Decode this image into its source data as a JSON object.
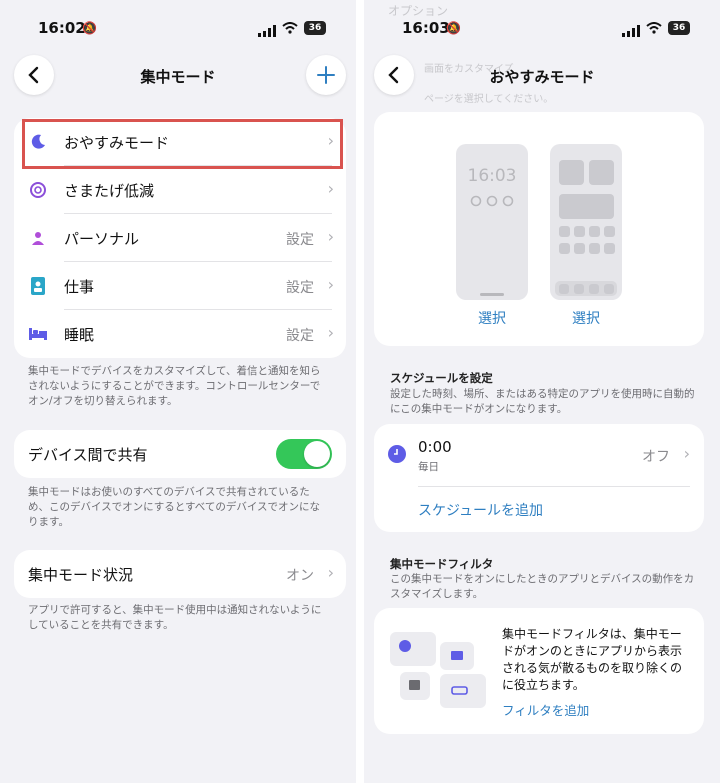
{
  "left": {
    "status": {
      "time": "16:02",
      "battery": "36"
    },
    "nav": {
      "title": "集中モード"
    },
    "modes": [
      {
        "label": "おやすみモード",
        "value": ""
      },
      {
        "label": "さまたげ低減",
        "value": ""
      },
      {
        "label": "パーソナル",
        "value": "設定"
      },
      {
        "label": "仕事",
        "value": "設定"
      },
      {
        "label": "睡眠",
        "value": "設定"
      }
    ],
    "note1": "集中モードでデバイスをカスタマイズして、着信と通知を知らされないようにすることができます。コントロールセンターでオン/オフを切り替えられます。",
    "share_label": "デバイス間で共有",
    "share_on": true,
    "note2": "集中モードはお使いのすべてのデバイスで共有されているため、このデバイスでオンにするとすべてのデバイスでオンになります。",
    "status_row": {
      "label": "集中モード状況",
      "value": "オン"
    },
    "note3": "アプリで許可すると、集中モード使用中は通知されないようにしていることを共有できます。"
  },
  "right": {
    "status": {
      "time": "16:03",
      "battery": "36"
    },
    "nav": {
      "title": "おやすみモード"
    },
    "ghost": {
      "top": "オプション",
      "a": "画面をカスタマイズ",
      "b": "ページを選択してください。"
    },
    "lock_time": "16:03",
    "select1": "選択",
    "select2": "選択",
    "schedule": {
      "title": "スケジュールを設定",
      "desc": "設定した時刻、場所、またはある特定のアプリを使用時に自動的にこの集中モードがオンになります。",
      "time": "0:00",
      "repeat": "毎日",
      "state": "オフ",
      "add": "スケジュールを追加"
    },
    "filter": {
      "title": "集中モードフィルタ",
      "desc": "この集中モードをオンにしたときのアプリとデバイスの動作をカスタマイズします。",
      "body": "集中モードフィルタは、集中モードがオンのときにアプリから表示される気が散るものを取り除くのに役立ちます。",
      "add": "フィルタを追加"
    }
  },
  "colors": {
    "accent": "#2f7fc1",
    "toggle": "#34c759",
    "highlight": "#d9534f",
    "mode_purple": "#5e5ce6"
  }
}
